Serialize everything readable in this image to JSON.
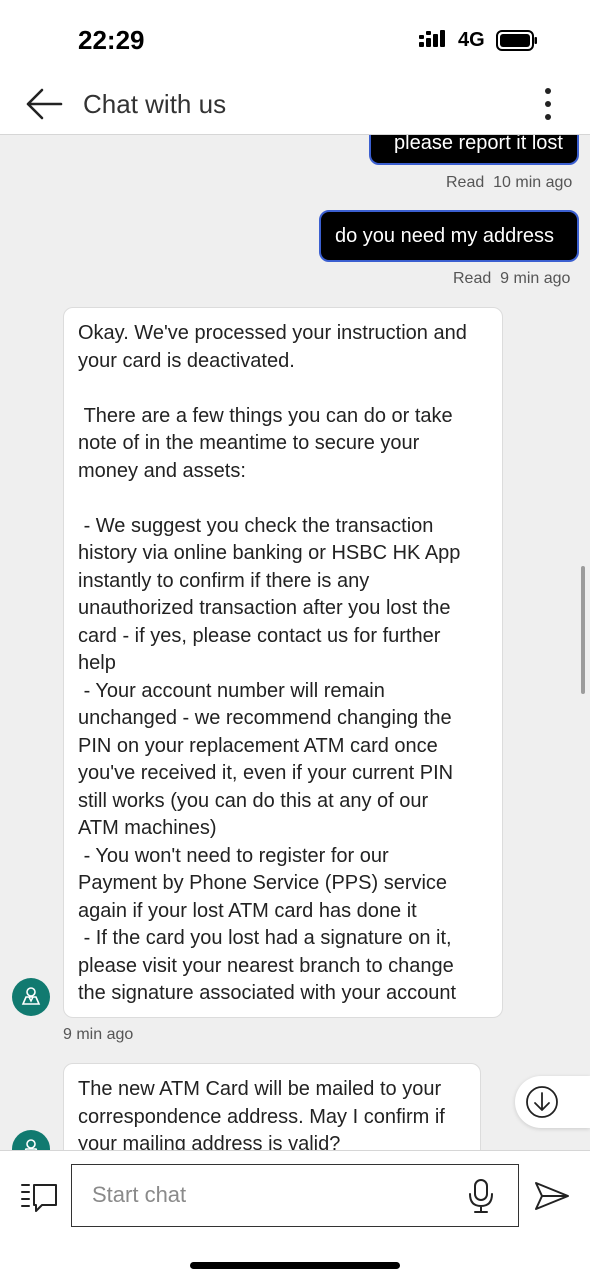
{
  "status_bar": {
    "time": "22:29",
    "network": "4G"
  },
  "header": {
    "title": "Chat with us"
  },
  "messages": {
    "out_1": {
      "text": "please report it lost",
      "status": "Read",
      "time": "10 min ago"
    },
    "out_2": {
      "text": "do you need my address",
      "status": "Read",
      "time": "9 min ago"
    },
    "in_1": {
      "text": "Okay. We've processed your instruction and\nyour card is deactivated.\n\n There are a few things you can do or take\nnote of in the meantime to secure your\nmoney and assets:\n\n - We suggest you check the transaction\nhistory via online banking or HSBC HK App\ninstantly to confirm if there is any\nunauthorized transaction after you lost the\ncard - if yes, please contact us for further\nhelp\n - Your account number will remain\nunchanged - we recommend changing the\nPIN on your replacement ATM card once\nyou've received it, even if your current PIN\nstill works (you can do this at any of our\nATM machines)\n - You won't need to register for our\nPayment by Phone Service (PPS) service\nagain if your lost ATM card has done it\n - If the card you lost had a signature on it,\nplease visit your nearest branch to change\nthe signature associated with your account",
      "time": "9 min ago"
    },
    "in_2": {
      "text": "The new ATM Card will be mailed to your\ncorrespondence address. May I confirm if\nyour mailing address is valid?"
    }
  },
  "composer": {
    "placeholder": "Start chat"
  },
  "colors": {
    "agent_avatar": "#117a70",
    "outgoing_bubble": "#000000",
    "outgoing_border": "#3b5fd0",
    "chat_background": "#efefef"
  },
  "icons": [
    "back-arrow-icon",
    "more-vertical-icon",
    "agent-icon",
    "arrow-down-circle-icon",
    "menu-list-icon",
    "microphone-icon",
    "send-icon",
    "signal-icon",
    "battery-icon"
  ]
}
